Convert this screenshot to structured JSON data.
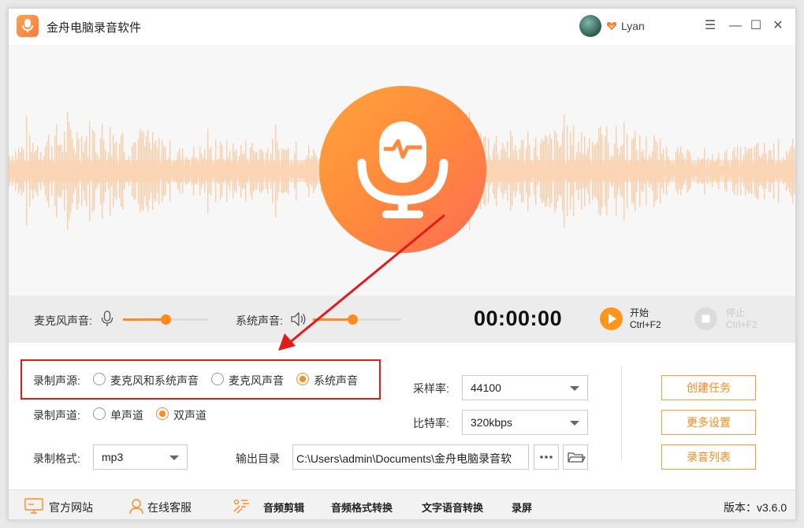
{
  "app": {
    "title": "金舟电脑录音软件",
    "username": "Lyan"
  },
  "icons": {
    "logo": "microphone-logo-icon",
    "vip": "vip-heart-icon",
    "minimize": "minimize-icon",
    "maximize": "maximize-icon",
    "close": "close-icon",
    "menu": "menu-icon",
    "mic": "microphone-icon",
    "speaker": "speaker-icon",
    "play": "play-icon",
    "stop": "stop-icon",
    "folder": "folder-icon",
    "more": "more-icon",
    "website": "monitor-icon",
    "support": "headset-icon",
    "audio_edit": "audio-edit-icon"
  },
  "colors": {
    "accent": "#ff8a1e",
    "highlight": "#e21b1b"
  },
  "controls": {
    "mic_volume_label": "麦克风声音:",
    "mic_volume_level": 0.5,
    "system_volume_label": "系统声音:",
    "system_volume_level": 0.45,
    "timer": "00:00:00",
    "start_label": "开始",
    "start_shortcut": "Ctrl+F2",
    "stop_label": "停止",
    "stop_shortcut": "Ctrl+F2"
  },
  "settings": {
    "source_label": "录制声源:",
    "source_options": [
      "麦克风和系统声音",
      "麦克风声音",
      "系统声音"
    ],
    "source_selected": "系统声音",
    "channel_label": "录制声道:",
    "channel_options": [
      "单声道",
      "双声道"
    ],
    "channel_selected": "双声道",
    "format_label": "录制格式:",
    "format_value": "mp3",
    "sample_rate_label": "采样率:",
    "sample_rate_value": "44100",
    "bitrate_label": "比特率:",
    "bitrate_value": "320kbps",
    "output_label": "输出目录",
    "output_path": "C:\\Users\\admin\\Documents\\金舟电脑录音软",
    "create_task": "创建任务",
    "more_settings": "更多设置",
    "recording_list": "录音列表"
  },
  "bottom": {
    "website": "官方网站",
    "support": "在线客服",
    "audio_edit": "音频剪辑",
    "format_convert": "音频格式转换",
    "tts": "文字语音转换",
    "screen_record": "录屏",
    "version": "版本：v3.6.0"
  }
}
